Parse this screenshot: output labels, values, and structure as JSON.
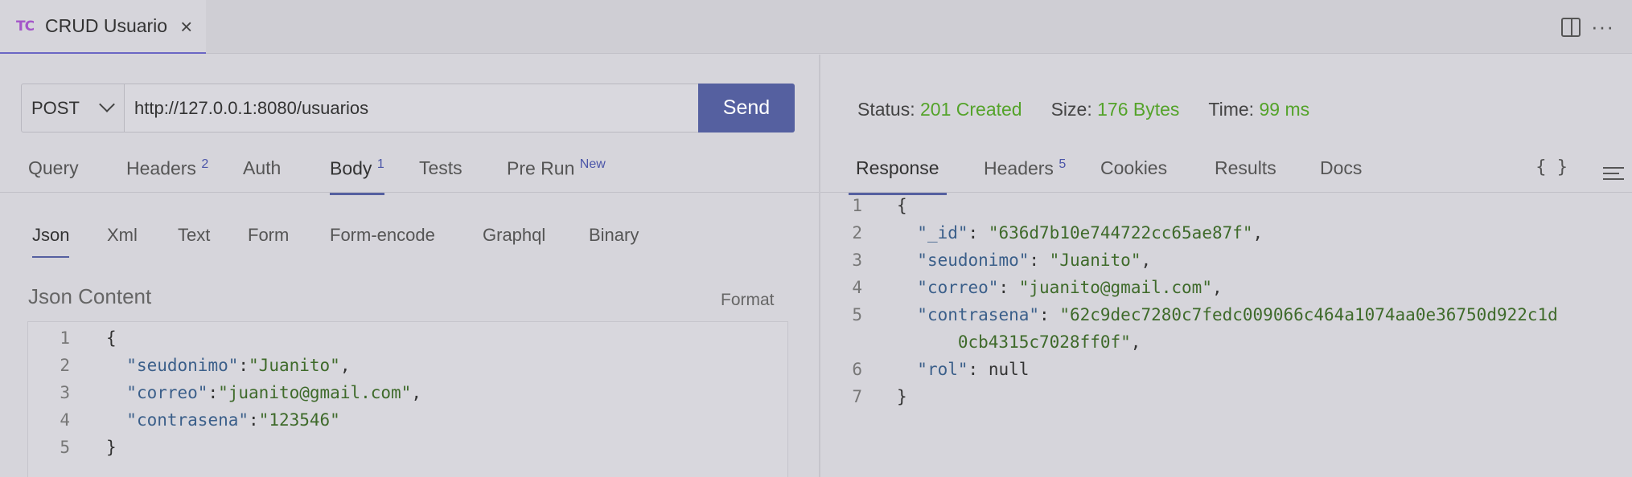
{
  "tab": {
    "icon_text": "TC",
    "title": "CRUD Usuario",
    "close": "×"
  },
  "window": {
    "split_icon": "split-editor-icon",
    "more": "···"
  },
  "request": {
    "method": "POST",
    "url": "http://127.0.0.1:8080/usuarios",
    "send_label": "Send",
    "tabs": [
      {
        "label": "Query",
        "badge": ""
      },
      {
        "label": "Headers",
        "badge": "2"
      },
      {
        "label": "Auth",
        "badge": ""
      },
      {
        "label": "Body",
        "badge": "1"
      },
      {
        "label": "Tests",
        "badge": ""
      },
      {
        "label": "Pre Run",
        "badge": "New"
      }
    ],
    "body_tabs": [
      "Json",
      "Xml",
      "Text",
      "Form",
      "Form-encode",
      "Graphql",
      "Binary"
    ],
    "json_label": "Json Content",
    "format_label": "Format",
    "editor_lines": [
      {
        "n": "1",
        "pre": "{",
        "key": "",
        "sep": "",
        "val": "",
        "post": ""
      },
      {
        "n": "2",
        "pre": "  ",
        "key": "\"seudonimo\"",
        "sep": ":",
        "val": "\"Juanito\"",
        "post": ","
      },
      {
        "n": "3",
        "pre": "  ",
        "key": "\"correo\"",
        "sep": ":",
        "val": "\"juanito@gmail.com\"",
        "post": ","
      },
      {
        "n": "4",
        "pre": "  ",
        "key": "\"contrasena\"",
        "sep": ":",
        "val": "\"123546\"",
        "post": ""
      },
      {
        "n": "5",
        "pre": "}",
        "key": "",
        "sep": "",
        "val": "",
        "post": ""
      }
    ]
  },
  "response": {
    "status_label": "Status:",
    "status_value": "201 Created",
    "size_label": "Size:",
    "size_value": "176 Bytes",
    "time_label": "Time:",
    "time_value": "99 ms",
    "tabs": [
      {
        "label": "Response",
        "badge": ""
      },
      {
        "label": "Headers",
        "badge": "5"
      },
      {
        "label": "Cookies",
        "badge": ""
      },
      {
        "label": "Results",
        "badge": ""
      },
      {
        "label": "Docs",
        "badge": ""
      }
    ],
    "braces": "{ }",
    "lines": [
      {
        "n": "1",
        "pre": "{",
        "key": "",
        "sep": "",
        "val": "",
        "post": ""
      },
      {
        "n": "2",
        "pre": "  ",
        "key": "\"_id\"",
        "sep": ": ",
        "val": "\"636d7b10e744722cc65ae87f\"",
        "post": ","
      },
      {
        "n": "3",
        "pre": "  ",
        "key": "\"seudonimo\"",
        "sep": ": ",
        "val": "\"Juanito\"",
        "post": ","
      },
      {
        "n": "4",
        "pre": "  ",
        "key": "\"correo\"",
        "sep": ": ",
        "val": "\"juanito@gmail.com\"",
        "post": ","
      },
      {
        "n": "5",
        "pre": "  ",
        "key": "\"contrasena\"",
        "sep": ": ",
        "val": "\"62c9dec7280c7fedc009066c464a1074aa0e36750d922c1d",
        "post": ""
      },
      {
        "n": "",
        "pre": "      ",
        "key": "",
        "sep": "",
        "val": "0cb4315c7028ff0f\"",
        "post": ","
      },
      {
        "n": "6",
        "pre": "  ",
        "key": "\"rol\"",
        "sep": ": ",
        "val": "",
        "post": "null"
      },
      {
        "n": "7",
        "pre": "}",
        "key": "",
        "sep": "",
        "val": "",
        "post": ""
      }
    ]
  }
}
